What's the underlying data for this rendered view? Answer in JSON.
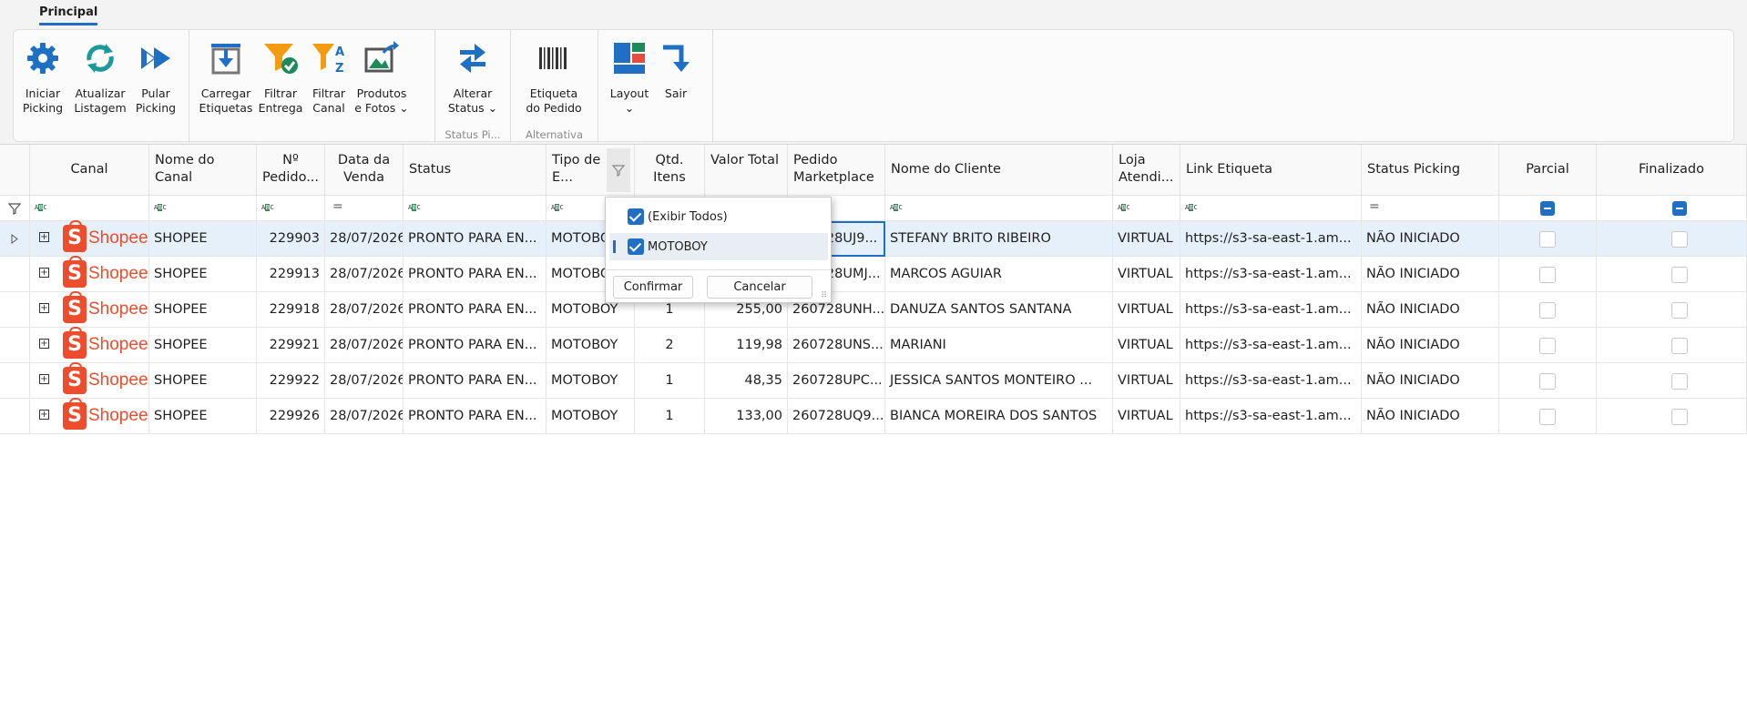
{
  "ribbon": {
    "tab": "Principal",
    "buttons": {
      "iniciar": "Iniciar\nPicking",
      "atualizar": "Atualizar\nListagem",
      "pular": "Pular\nPicking",
      "carregar": "Carregar\nEtiquetas",
      "filtrar_entrega": "Filtrar\nEntrega",
      "filtrar_canal": "Filtrar\nCanal",
      "produtos": "Produtos\ne Fotos ⌄",
      "alterar": "Alterar\nStatus ⌄",
      "etiqueta": "Etiqueta\ndo Pedido",
      "layout": "Layout\n⌄",
      "sair": "Sair"
    },
    "groups": {
      "status": "Status Pi...",
      "alternativa": "Alternativa"
    }
  },
  "grid": {
    "headers": {
      "canal": "Canal",
      "nome_canal": "Nome do Canal",
      "pedido": "Nº Pedido...",
      "data": "Data da Venda",
      "status": "Status",
      "tipo": "Tipo de E...",
      "qtd": "Qtd. Itens",
      "valor": "Valor Total",
      "pedido_mkt": "Pedido Marketplace",
      "cliente": "Nome do Cliente",
      "loja": "Loja Atendi...",
      "link": "Link Etiqueta",
      "status_picking": "Status Picking",
      "parcial": "Parcial",
      "finalizado": "Finalizado"
    },
    "channel_logo": "Shopee",
    "rows": [
      {
        "canal": "SHOPEE",
        "pedido": "229903",
        "data": "28/07/2026",
        "status": "PRONTO PARA EN...",
        "tipo": "MOTOBOY",
        "qtd": "",
        "valor": "",
        "pedido_mkt": "260728UJ9...",
        "cliente": "STEFANY BRITO RIBEIRO",
        "loja": "VIRTUAL",
        "link": "https://s3-sa-east-1.am...",
        "status_picking": "NÃO INICIADO"
      },
      {
        "canal": "SHOPEE",
        "pedido": "229913",
        "data": "28/07/2026",
        "status": "PRONTO PARA EN...",
        "tipo": "MOTOBOY",
        "qtd": "",
        "valor": "",
        "pedido_mkt": "260728UMJ...",
        "cliente": "MARCOS AGUIAR",
        "loja": "VIRTUAL",
        "link": "https://s3-sa-east-1.am...",
        "status_picking": "NÃO INICIADO"
      },
      {
        "canal": "SHOPEE",
        "pedido": "229918",
        "data": "28/07/2026",
        "status": "PRONTO PARA EN...",
        "tipo": "MOTOBOY",
        "qtd": "1",
        "valor": "255,00",
        "pedido_mkt": "260728UNH...",
        "cliente": "DANUZA SANTOS SANTANA",
        "loja": "VIRTUAL",
        "link": "https://s3-sa-east-1.am...",
        "status_picking": "NÃO INICIADO"
      },
      {
        "canal": "SHOPEE",
        "pedido": "229921",
        "data": "28/07/2026",
        "status": "PRONTO PARA EN...",
        "tipo": "MOTOBOY",
        "qtd": "2",
        "valor": "119,98",
        "pedido_mkt": "260728UNS...",
        "cliente": "MARIANI",
        "loja": "VIRTUAL",
        "link": "https://s3-sa-east-1.am...",
        "status_picking": "NÃO INICIADO"
      },
      {
        "canal": "SHOPEE",
        "pedido": "229922",
        "data": "28/07/2026",
        "status": "PRONTO PARA EN...",
        "tipo": "MOTOBOY",
        "qtd": "1",
        "valor": "48,35",
        "pedido_mkt": "260728UPC...",
        "cliente": "JESSICA SANTOS MONTEIRO ...",
        "loja": "VIRTUAL",
        "link": "https://s3-sa-east-1.am...",
        "status_picking": "NÃO INICIADO"
      },
      {
        "canal": "SHOPEE",
        "pedido": "229926",
        "data": "28/07/2026",
        "status": "PRONTO PARA EN...",
        "tipo": "MOTOBOY",
        "qtd": "1",
        "valor": "133,00",
        "pedido_mkt": "260728UQ9...",
        "cliente": "BIANCA MOREIRA DOS SANTOS",
        "loja": "VIRTUAL",
        "link": "https://s3-sa-east-1.am...",
        "status_picking": "NÃO INICIADO"
      }
    ]
  },
  "filter_popup": {
    "items": [
      "(Exibir Todos)",
      "MOTOBOY"
    ],
    "confirm": "Confirmar",
    "cancel": "Cancelar"
  },
  "colors": {
    "accent": "#1f6fc5",
    "shopee": "#ee4d2d"
  }
}
